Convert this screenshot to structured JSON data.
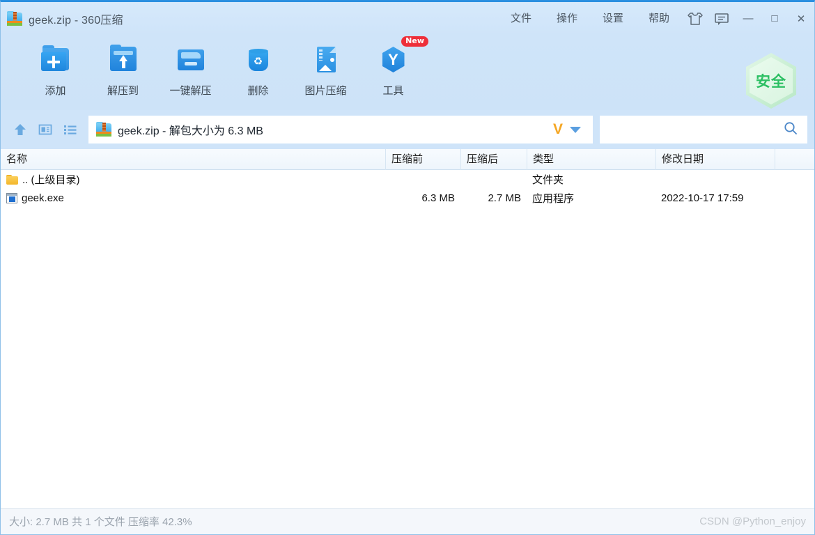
{
  "window": {
    "title": "geek.zip - 360压缩",
    "app_icon": "zip-folder-icon",
    "menus": [
      {
        "label": "文件",
        "name": "menu-file"
      },
      {
        "label": "操作",
        "name": "menu-operation"
      },
      {
        "label": "设置",
        "name": "menu-settings"
      },
      {
        "label": "帮助",
        "name": "menu-help"
      }
    ],
    "icon_buttons": [
      {
        "name": "skin-icon",
        "title": "换肤"
      },
      {
        "name": "feedback-icon",
        "title": "反馈"
      }
    ],
    "controls": {
      "minimize": "—",
      "maximize": "□",
      "close": "✕"
    }
  },
  "toolbar": {
    "buttons": [
      {
        "label": "添加",
        "icon": "add-folder-icon"
      },
      {
        "label": "解压到",
        "icon": "extract-to-icon"
      },
      {
        "label": "一键解压",
        "icon": "one-click-extract-icon"
      },
      {
        "label": "删除",
        "icon": "delete-icon"
      },
      {
        "label": "图片压缩",
        "icon": "image-compress-icon"
      },
      {
        "label": "工具",
        "icon": "tools-icon",
        "badge": "New"
      }
    ],
    "security_badge": {
      "label": "安全",
      "color": "#2bbf62"
    }
  },
  "addressbar": {
    "up_icon": "up-arrow-icon",
    "view_icon": "view-panel-icon",
    "list_icon": "list-view-icon",
    "file_icon": "zip-folder-icon",
    "path_text": "geek.zip - 解包大小为 6.3 MB",
    "v_badge": "V",
    "dropdown_icon": "chevron-down-icon",
    "search_placeholder": "",
    "search_value": "",
    "search_icon": "search-icon"
  },
  "filelist": {
    "columns": [
      {
        "label": "名称",
        "key": "name"
      },
      {
        "label": "压缩前",
        "key": "size_before"
      },
      {
        "label": "压缩后",
        "key": "size_after"
      },
      {
        "label": "类型",
        "key": "type"
      },
      {
        "label": "修改日期",
        "key": "modified"
      }
    ],
    "rows": [
      {
        "icon": "folder-icon",
        "name": ".. (上级目录)",
        "size_before": "",
        "size_after": "",
        "type": "文件夹",
        "modified": ""
      },
      {
        "icon": "exe-icon",
        "name": "geek.exe",
        "size_before": "6.3 MB",
        "size_after": "2.7 MB",
        "type": "应用程序",
        "modified": "2022-10-17 17:59"
      }
    ]
  },
  "statusbar": {
    "summary": "大小: 2.7 MB 共 1 个文件 压缩率 42.3%",
    "watermark": "CSDN @Python_enjoy"
  }
}
